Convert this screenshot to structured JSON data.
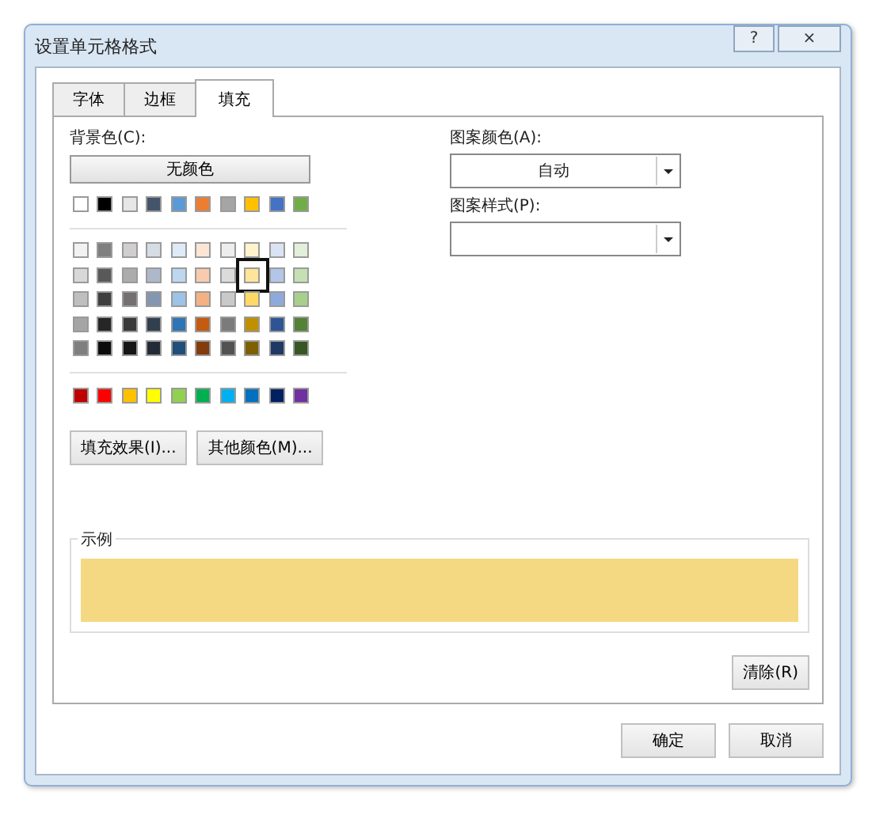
{
  "window": {
    "title": "设置单元格格式",
    "help": "?",
    "close": "×"
  },
  "tabs": [
    {
      "label": "字体",
      "selected": false
    },
    {
      "label": "边框",
      "selected": false
    },
    {
      "label": "填充",
      "selected": true
    }
  ],
  "background": {
    "label": "背景色(C):",
    "no_color": "无颜色",
    "palette": [
      [
        {
          "color": "#ffffff",
          "selected": false
        },
        {
          "color": "#000000",
          "selected": false
        },
        {
          "color": "#e7e6e6",
          "selected": false
        },
        {
          "color": "#44546a",
          "selected": false
        },
        {
          "color": "#5b9bd5",
          "selected": false
        },
        {
          "color": "#ed7d31",
          "selected": false
        },
        {
          "color": "#a5a5a5",
          "selected": false
        },
        {
          "color": "#ffc000",
          "selected": false
        },
        {
          "color": "#4472c4",
          "selected": false
        },
        {
          "color": "#70ad47",
          "selected": false
        }
      ],
      [
        {
          "color": "#f2f2f2",
          "selected": false
        },
        {
          "color": "#7f7f7f",
          "selected": false
        },
        {
          "color": "#d0cece",
          "selected": false
        },
        {
          "color": "#d6dce4",
          "selected": false
        },
        {
          "color": "#deebf6",
          "selected": false
        },
        {
          "color": "#fbe5d5",
          "selected": false
        },
        {
          "color": "#ededed",
          "selected": false
        },
        {
          "color": "#fff2cc",
          "selected": false
        },
        {
          "color": "#dae3f3",
          "selected": false
        },
        {
          "color": "#e2efd9",
          "selected": false
        }
      ],
      [
        {
          "color": "#d8d8d8",
          "selected": false
        },
        {
          "color": "#595959",
          "selected": false
        },
        {
          "color": "#aeabab",
          "selected": false
        },
        {
          "color": "#adb9ca",
          "selected": false
        },
        {
          "color": "#bdd7ee",
          "selected": false
        },
        {
          "color": "#f7cbac",
          "selected": false
        },
        {
          "color": "#dbdbdb",
          "selected": false
        },
        {
          "color": "#fee599",
          "selected": true
        },
        {
          "color": "#b4c6e7",
          "selected": false
        },
        {
          "color": "#c5e0b3",
          "selected": false
        }
      ],
      [
        {
          "color": "#bfbfbf",
          "selected": false
        },
        {
          "color": "#3f3f3f",
          "selected": false
        },
        {
          "color": "#757070",
          "selected": false
        },
        {
          "color": "#8496b0",
          "selected": false
        },
        {
          "color": "#9dc3e6",
          "selected": false
        },
        {
          "color": "#f4b183",
          "selected": false
        },
        {
          "color": "#c9c9c9",
          "selected": false
        },
        {
          "color": "#ffd965",
          "selected": false
        },
        {
          "color": "#8eaadb",
          "selected": false
        },
        {
          "color": "#a8d08d",
          "selected": false
        }
      ],
      [
        {
          "color": "#a5a5a5",
          "selected": false
        },
        {
          "color": "#262626",
          "selected": false
        },
        {
          "color": "#3a3838",
          "selected": false
        },
        {
          "color": "#323f4f",
          "selected": false
        },
        {
          "color": "#2e75b5",
          "selected": false
        },
        {
          "color": "#c55a11",
          "selected": false
        },
        {
          "color": "#7b7b7b",
          "selected": false
        },
        {
          "color": "#bf9000",
          "selected": false
        },
        {
          "color": "#2f5496",
          "selected": false
        },
        {
          "color": "#538135",
          "selected": false
        }
      ],
      [
        {
          "color": "#7f7f7f",
          "selected": false
        },
        {
          "color": "#0c0c0c",
          "selected": false
        },
        {
          "color": "#171616",
          "selected": false
        },
        {
          "color": "#222a35",
          "selected": false
        },
        {
          "color": "#1e4e79",
          "selected": false
        },
        {
          "color": "#833c0b",
          "selected": false
        },
        {
          "color": "#525252",
          "selected": false
        },
        {
          "color": "#7f6000",
          "selected": false
        },
        {
          "color": "#1f3864",
          "selected": false
        },
        {
          "color": "#375623",
          "selected": false
        }
      ],
      [
        {
          "color": "#c00000",
          "selected": false
        },
        {
          "color": "#ff0000",
          "selected": false
        },
        {
          "color": "#ffc000",
          "selected": false
        },
        {
          "color": "#ffff00",
          "selected": false
        },
        {
          "color": "#92d050",
          "selected": false
        },
        {
          "color": "#00b050",
          "selected": false
        },
        {
          "color": "#00b0f0",
          "selected": false
        },
        {
          "color": "#0070c0",
          "selected": false
        },
        {
          "color": "#002060",
          "selected": false
        },
        {
          "color": "#7030a0",
          "selected": false
        }
      ]
    ],
    "buttons": [
      "填充效果(I)...",
      "其他颜色(M)..."
    ]
  },
  "pattern_color": {
    "label": "图案颜色(A):",
    "value": "自动"
  },
  "pattern_style": {
    "label": "图案样式(P):"
  },
  "sample": {
    "label": "示例",
    "color": "#f5d882"
  },
  "clear_button": "清除(R)",
  "buttons": [
    "确定",
    "取消"
  ]
}
